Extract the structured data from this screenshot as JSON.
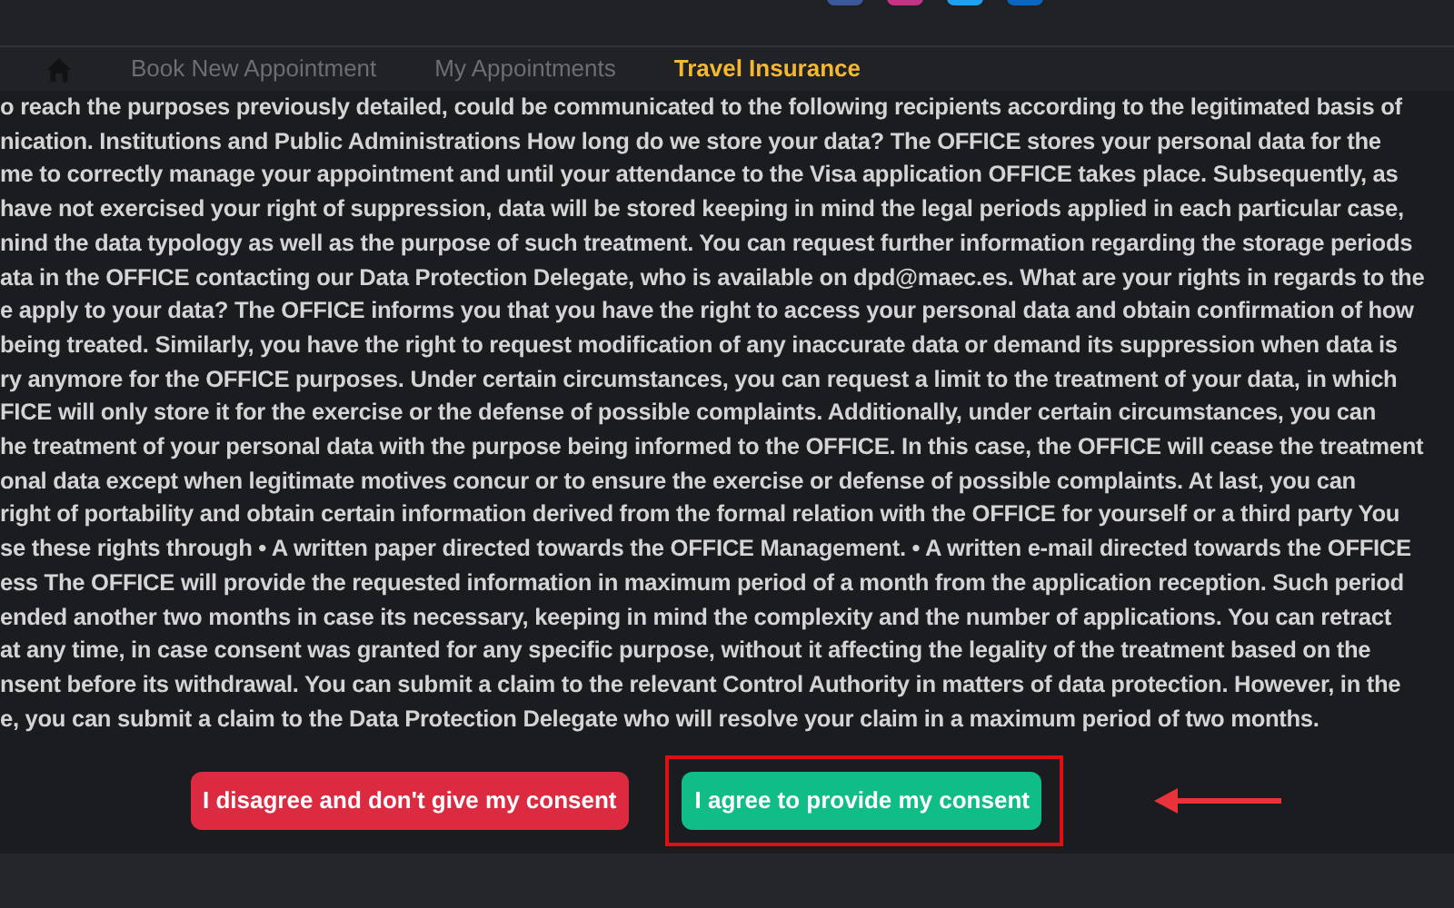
{
  "nav": {
    "tabs": [
      {
        "kind": "home",
        "selected": false
      },
      {
        "label": "Book New Appointment",
        "selected": false
      },
      {
        "label": "My Appointments",
        "selected": false
      },
      {
        "label": "Travel Insurance",
        "selected": true
      }
    ]
  },
  "consent_text": [
    "o reach the purposes previously detailed, could be communicated to the following recipients according to the legitimated basis of",
    "nication. Institutions and Public Administrations How long do we store your data? The OFFICE stores your personal data for the",
    "me to correctly manage your appointment and until your attendance to the Visa application OFFICE takes place. Subsequently, as",
    "have not exercised your right of suppression, data will be stored keeping in mind the legal periods applied in each particular case,",
    "nind the data typology as well as the purpose of such treatment. You can request further information regarding the storage periods",
    "ata in the OFFICE contacting our Data Protection Delegate, who is available on dpd@maec.es. What are your rights in regards to the",
    "e apply to your data? The OFFICE informs you that you have the right to access your personal data and obtain confirmation of how",
    "being treated. Similarly, you have the right to request modification of any inaccurate data or demand its suppression when data is",
    "ry anymore for the OFFICE purposes. Under certain circumstances, you can request a limit to the treatment of your data, in which",
    "FICE will only store it for the exercise or the defense of possible complaints. Additionally, under certain circumstances, you can",
    "he treatment of your personal data with the purpose being informed to the OFFICE. In this case, the OFFICE will cease the treatment",
    "onal data except when legitimate motives concur or to ensure the exercise or defense of possible complaints. At last, you can",
    "right of portability and obtain certain information derived from the formal relation with the OFFICE for yourself or a third party You",
    "se these rights through • A written paper directed towards the OFFICE Management. • A written e-mail directed towards the OFFICE",
    "ess The OFFICE will provide the requested information in maximum period of a month from the application reception. Such period",
    "ended another two months in case its necessary, keeping in mind the complexity and the number of applications. You can retract",
    "at any time, in case consent was granted for any specific purpose, without it affecting the legality of the treatment based on the",
    "nsent before its withdrawal. You can submit a claim to the relevant Control Authority in matters of data protection. However, in the",
    "e, you can submit a claim to the Data Protection Delegate who will resolve your claim in a maximum period of two months."
  ],
  "buttons": [
    {
      "label": "I disagree and don't give my consent",
      "kind": "decline",
      "highlighted": false
    },
    {
      "label": "I agree to provide my consent",
      "kind": "accept",
      "highlighted": true
    }
  ]
}
